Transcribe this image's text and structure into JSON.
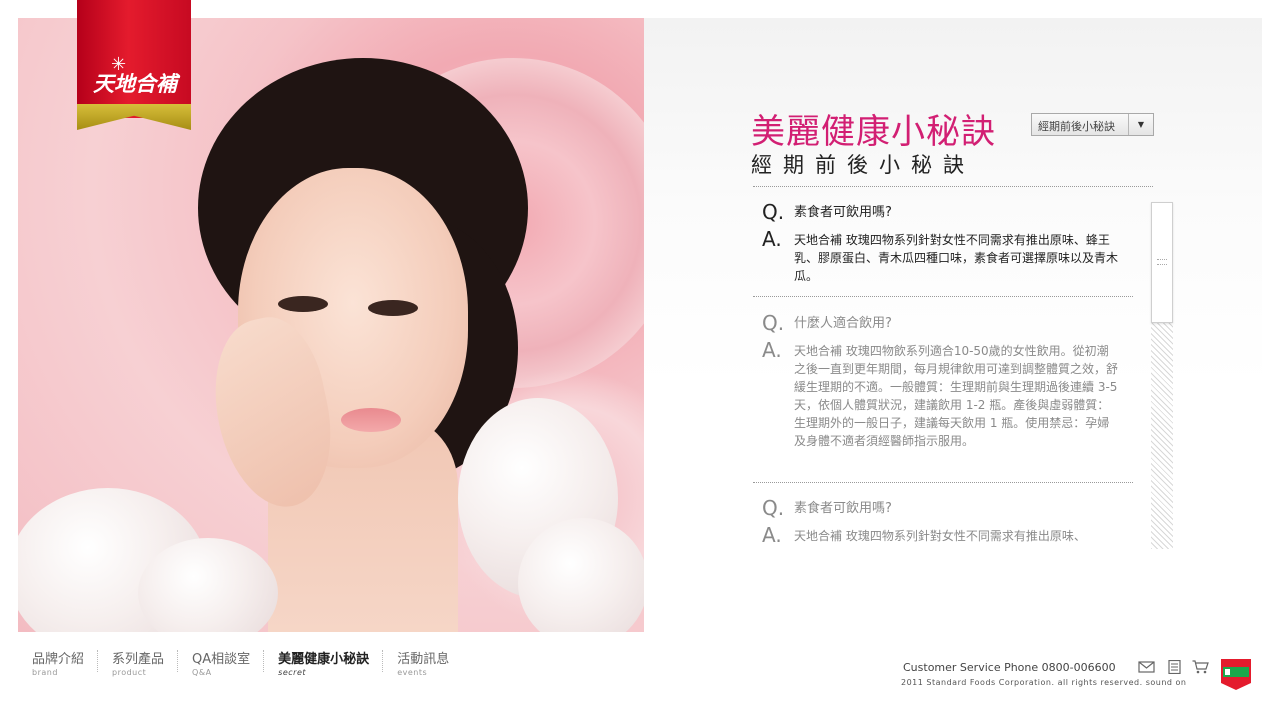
{
  "logo": {
    "text": "天地合補"
  },
  "header": {
    "title": "美麗健康小秘訣",
    "subtitle": "經期前後小秘訣",
    "category_select": {
      "value": "經期前後小秘訣"
    }
  },
  "qa_items": [
    {
      "q_mark": "Q.",
      "a_mark": "A.",
      "question": "素食者可飲用嗎?",
      "answer": "天地合補 玫瑰四物系列針對女性不同需求有推出原味、蜂王乳、膠原蛋白、青木瓜四種口味，素食者可選擇原味以及青木瓜。",
      "state": "active"
    },
    {
      "q_mark": "Q.",
      "a_mark": "A.",
      "question": "什麼人適合飲用?",
      "answer": "天地合補 玫瑰四物飲系列適合10-50歲的女性飲用。從初潮之後一直到更年期間，每月規律飲用可達到調整體質之效，舒緩生理期的不適。一般體質：生理期前與生理期過後連續 3-5 天，依個人體質狀況，建議飲用 1-2 瓶。產後與虛弱體質：生理期外的一般日子，建議每天飲用 1 瓶。使用禁忌：孕婦及身體不適者須經醫師指示服用。",
      "state": "dim"
    },
    {
      "q_mark": "Q.",
      "a_mark": "A.",
      "question": "素食者可飲用嗎?",
      "answer": "天地合補 玫瑰四物系列針對女性不同需求有推出原味、",
      "state": "dim"
    }
  ],
  "nav": [
    {
      "zh": "品牌介紹",
      "en": "brand",
      "active": false
    },
    {
      "zh": "系列產品",
      "en": "product",
      "active": false
    },
    {
      "zh": "QA相談室",
      "en": "Q&A",
      "active": false
    },
    {
      "zh": "美麗健康小秘訣",
      "en": "secret",
      "active": true
    },
    {
      "zh": "活動訊息",
      "en": "events",
      "active": false
    }
  ],
  "footer": {
    "customer_service": "Customer Service Phone  0800-006600",
    "copyright": "2011 Standard Foods Corporation. all rights reserved. sound on",
    "icons": [
      "mail-icon",
      "document-icon",
      "cart-icon",
      "standard-foods-logo"
    ]
  },
  "colors": {
    "title": "#d21f73",
    "logo_red": "#e41b2d",
    "logo_gold": "#c9ac23",
    "brand_green": "#1aa84b"
  }
}
